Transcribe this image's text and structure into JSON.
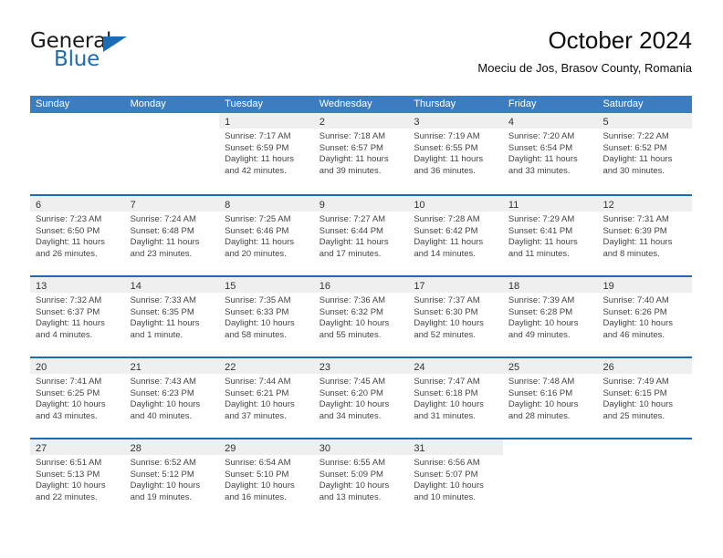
{
  "brand": {
    "line1": "General",
    "line2": "Blue",
    "accent_color": "#1b6cb5"
  },
  "header": {
    "month_title": "October 2024",
    "location": "Moeciu de Jos, Brasov County, Romania"
  },
  "calendar": {
    "header_bg": "#3b7dc0",
    "day_band_bg": "#efefef",
    "row_separator_color": "#1b6cb5",
    "weekdays": [
      "Sunday",
      "Monday",
      "Tuesday",
      "Wednesday",
      "Thursday",
      "Friday",
      "Saturday"
    ],
    "weeks": [
      [
        {
          "day": "",
          "blank": true,
          "lines": []
        },
        {
          "day": "",
          "blank": true,
          "lines": []
        },
        {
          "day": "1",
          "lines": [
            "Sunrise: 7:17 AM",
            "Sunset: 6:59 PM",
            "Daylight: 11 hours",
            "and 42 minutes."
          ]
        },
        {
          "day": "2",
          "lines": [
            "Sunrise: 7:18 AM",
            "Sunset: 6:57 PM",
            "Daylight: 11 hours",
            "and 39 minutes."
          ]
        },
        {
          "day": "3",
          "lines": [
            "Sunrise: 7:19 AM",
            "Sunset: 6:55 PM",
            "Daylight: 11 hours",
            "and 36 minutes."
          ]
        },
        {
          "day": "4",
          "lines": [
            "Sunrise: 7:20 AM",
            "Sunset: 6:54 PM",
            "Daylight: 11 hours",
            "and 33 minutes."
          ]
        },
        {
          "day": "5",
          "lines": [
            "Sunrise: 7:22 AM",
            "Sunset: 6:52 PM",
            "Daylight: 11 hours",
            "and 30 minutes."
          ]
        }
      ],
      [
        {
          "day": "6",
          "lines": [
            "Sunrise: 7:23 AM",
            "Sunset: 6:50 PM",
            "Daylight: 11 hours",
            "and 26 minutes."
          ]
        },
        {
          "day": "7",
          "lines": [
            "Sunrise: 7:24 AM",
            "Sunset: 6:48 PM",
            "Daylight: 11 hours",
            "and 23 minutes."
          ]
        },
        {
          "day": "8",
          "lines": [
            "Sunrise: 7:25 AM",
            "Sunset: 6:46 PM",
            "Daylight: 11 hours",
            "and 20 minutes."
          ]
        },
        {
          "day": "9",
          "lines": [
            "Sunrise: 7:27 AM",
            "Sunset: 6:44 PM",
            "Daylight: 11 hours",
            "and 17 minutes."
          ]
        },
        {
          "day": "10",
          "lines": [
            "Sunrise: 7:28 AM",
            "Sunset: 6:42 PM",
            "Daylight: 11 hours",
            "and 14 minutes."
          ]
        },
        {
          "day": "11",
          "lines": [
            "Sunrise: 7:29 AM",
            "Sunset: 6:41 PM",
            "Daylight: 11 hours",
            "and 11 minutes."
          ]
        },
        {
          "day": "12",
          "lines": [
            "Sunrise: 7:31 AM",
            "Sunset: 6:39 PM",
            "Daylight: 11 hours",
            "and 8 minutes."
          ]
        }
      ],
      [
        {
          "day": "13",
          "lines": [
            "Sunrise: 7:32 AM",
            "Sunset: 6:37 PM",
            "Daylight: 11 hours",
            "and 4 minutes."
          ]
        },
        {
          "day": "14",
          "lines": [
            "Sunrise: 7:33 AM",
            "Sunset: 6:35 PM",
            "Daylight: 11 hours",
            "and 1 minute."
          ]
        },
        {
          "day": "15",
          "lines": [
            "Sunrise: 7:35 AM",
            "Sunset: 6:33 PM",
            "Daylight: 10 hours",
            "and 58 minutes."
          ]
        },
        {
          "day": "16",
          "lines": [
            "Sunrise: 7:36 AM",
            "Sunset: 6:32 PM",
            "Daylight: 10 hours",
            "and 55 minutes."
          ]
        },
        {
          "day": "17",
          "lines": [
            "Sunrise: 7:37 AM",
            "Sunset: 6:30 PM",
            "Daylight: 10 hours",
            "and 52 minutes."
          ]
        },
        {
          "day": "18",
          "lines": [
            "Sunrise: 7:39 AM",
            "Sunset: 6:28 PM",
            "Daylight: 10 hours",
            "and 49 minutes."
          ]
        },
        {
          "day": "19",
          "lines": [
            "Sunrise: 7:40 AM",
            "Sunset: 6:26 PM",
            "Daylight: 10 hours",
            "and 46 minutes."
          ]
        }
      ],
      [
        {
          "day": "20",
          "lines": [
            "Sunrise: 7:41 AM",
            "Sunset: 6:25 PM",
            "Daylight: 10 hours",
            "and 43 minutes."
          ]
        },
        {
          "day": "21",
          "lines": [
            "Sunrise: 7:43 AM",
            "Sunset: 6:23 PM",
            "Daylight: 10 hours",
            "and 40 minutes."
          ]
        },
        {
          "day": "22",
          "lines": [
            "Sunrise: 7:44 AM",
            "Sunset: 6:21 PM",
            "Daylight: 10 hours",
            "and 37 minutes."
          ]
        },
        {
          "day": "23",
          "lines": [
            "Sunrise: 7:45 AM",
            "Sunset: 6:20 PM",
            "Daylight: 10 hours",
            "and 34 minutes."
          ]
        },
        {
          "day": "24",
          "lines": [
            "Sunrise: 7:47 AM",
            "Sunset: 6:18 PM",
            "Daylight: 10 hours",
            "and 31 minutes."
          ]
        },
        {
          "day": "25",
          "lines": [
            "Sunrise: 7:48 AM",
            "Sunset: 6:16 PM",
            "Daylight: 10 hours",
            "and 28 minutes."
          ]
        },
        {
          "day": "26",
          "lines": [
            "Sunrise: 7:49 AM",
            "Sunset: 6:15 PM",
            "Daylight: 10 hours",
            "and 25 minutes."
          ]
        }
      ],
      [
        {
          "day": "27",
          "lines": [
            "Sunrise: 6:51 AM",
            "Sunset: 5:13 PM",
            "Daylight: 10 hours",
            "and 22 minutes."
          ]
        },
        {
          "day": "28",
          "lines": [
            "Sunrise: 6:52 AM",
            "Sunset: 5:12 PM",
            "Daylight: 10 hours",
            "and 19 minutes."
          ]
        },
        {
          "day": "29",
          "lines": [
            "Sunrise: 6:54 AM",
            "Sunset: 5:10 PM",
            "Daylight: 10 hours",
            "and 16 minutes."
          ]
        },
        {
          "day": "30",
          "lines": [
            "Sunrise: 6:55 AM",
            "Sunset: 5:09 PM",
            "Daylight: 10 hours",
            "and 13 minutes."
          ]
        },
        {
          "day": "31",
          "lines": [
            "Sunrise: 6:56 AM",
            "Sunset: 5:07 PM",
            "Daylight: 10 hours",
            "and 10 minutes."
          ]
        },
        {
          "day": "",
          "blank": true,
          "lines": []
        },
        {
          "day": "",
          "blank": true,
          "lines": []
        }
      ]
    ]
  }
}
